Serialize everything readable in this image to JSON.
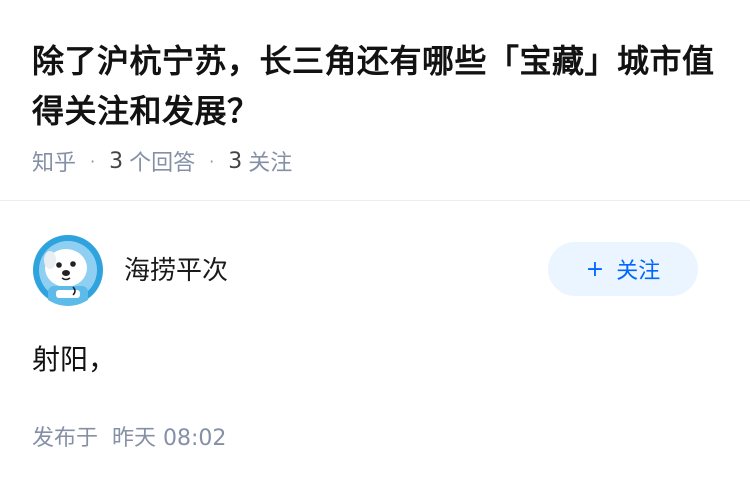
{
  "question": {
    "title": "除了沪杭宁苏，长三角还有哪些「宝藏」城市值得关注和发展？",
    "source": "知乎",
    "answer_count": "3",
    "answer_label": "个回答",
    "follower_count": "3",
    "follower_label": "关注"
  },
  "author": {
    "name": "海捞平次",
    "avatar_icon": "astronaut-dog-avatar"
  },
  "follow_button": {
    "plus": "+",
    "label": "关注"
  },
  "answer": {
    "text": "射阳，",
    "published_prefix": "发布于",
    "published_time": "昨天 08:02"
  },
  "colors": {
    "accent": "#0066ff",
    "follow_bg": "#ebf5ff",
    "meta_gray": "#8590a6"
  }
}
